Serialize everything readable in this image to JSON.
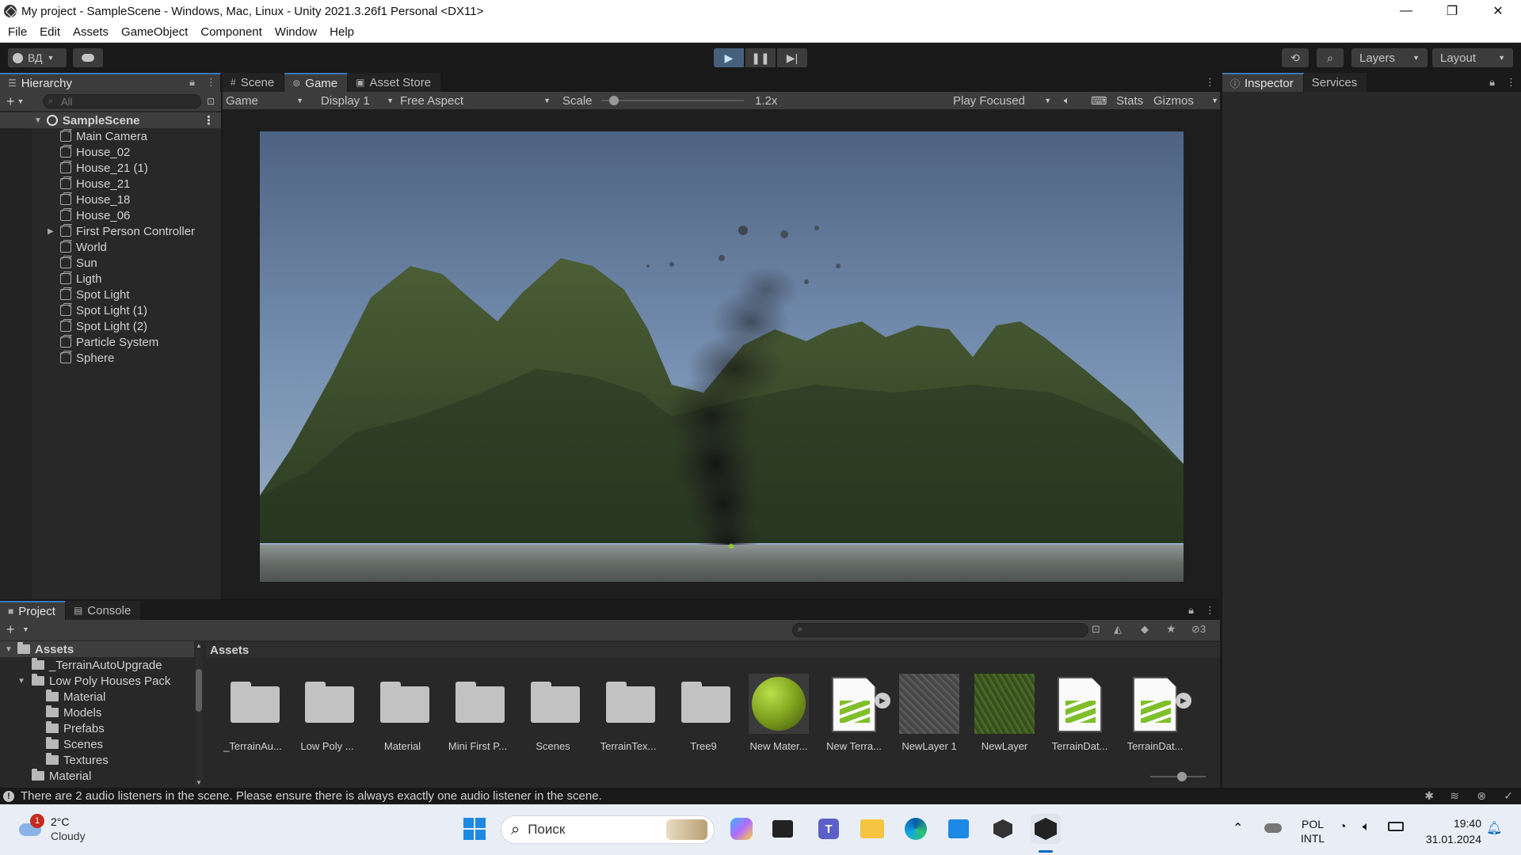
{
  "window": {
    "title": "My project - SampleScene - Windows, Mac, Linux - Unity 2021.3.26f1 Personal <DX11>",
    "minimize": "—",
    "maximize": "❐",
    "close": "✕"
  },
  "menu": [
    "File",
    "Edit",
    "Assets",
    "GameObject",
    "Component",
    "Window",
    "Help"
  ],
  "toolbar": {
    "account": "ВД",
    "layers": "Layers",
    "layout": "Layout"
  },
  "hierarchy": {
    "tab": "Hierarchy",
    "search_placeholder": "All",
    "scene": "SampleScene",
    "items": [
      {
        "label": "Main Camera"
      },
      {
        "label": "House_02"
      },
      {
        "label": "House_21 (1)"
      },
      {
        "label": "House_21"
      },
      {
        "label": "House_18"
      },
      {
        "label": "House_06"
      },
      {
        "label": "First Person Controller"
      },
      {
        "label": "World"
      },
      {
        "label": "Sun"
      },
      {
        "label": "Ligth"
      },
      {
        "label": "Spot Light"
      },
      {
        "label": "Spot Light (1)"
      },
      {
        "label": "Spot Light (2)"
      },
      {
        "label": "Particle System"
      },
      {
        "label": "Sphere"
      }
    ]
  },
  "center_tabs": [
    "Scene",
    "Game",
    "Asset Store"
  ],
  "game_options": {
    "view": "Game",
    "display": "Display 1",
    "aspect": "Free Aspect",
    "scale_label": "Scale",
    "scale_value": "1.2x",
    "play_mode": "Play Focused",
    "stats": "Stats",
    "gizmos": "Gizmos"
  },
  "inspector": {
    "tab": "Inspector",
    "services": "Services"
  },
  "project": {
    "tabs": [
      "Project",
      "Console"
    ],
    "hidden_count": "3",
    "breadcrumb": "Assets",
    "tree": [
      {
        "label": "Assets"
      },
      {
        "label": "_TerrainAutoUpgrade"
      },
      {
        "label": "Low Poly Houses Pack"
      },
      {
        "label": "Material"
      },
      {
        "label": "Models"
      },
      {
        "label": "Prefabs"
      },
      {
        "label": "Scenes"
      },
      {
        "label": "Textures"
      },
      {
        "label": "Material"
      }
    ],
    "assets": [
      {
        "label": "_TerrainAu...",
        "kind": "folder"
      },
      {
        "label": "Low Poly ...",
        "kind": "folder"
      },
      {
        "label": "Material",
        "kind": "folder"
      },
      {
        "label": "Mini First P...",
        "kind": "folder"
      },
      {
        "label": "Scenes",
        "kind": "folder"
      },
      {
        "label": "TerrainTex...",
        "kind": "folder"
      },
      {
        "label": "Tree9",
        "kind": "folder"
      },
      {
        "label": "New Mater...",
        "kind": "material"
      },
      {
        "label": "New Terra...",
        "kind": "terrain"
      },
      {
        "label": "NewLayer 1",
        "kind": "rock"
      },
      {
        "label": "NewLayer",
        "kind": "grass"
      },
      {
        "label": "TerrainDat...",
        "kind": "terrain"
      },
      {
        "label": "TerrainDat...",
        "kind": "terrain"
      }
    ]
  },
  "status": {
    "message": "There are 2 audio listeners in the scene. Please ensure there is always exactly one audio listener in the scene."
  },
  "taskbar": {
    "weather_temp": "2°C",
    "weather_desc": "Cloudy",
    "weather_badge": "1",
    "search_placeholder": "Поиск",
    "lang1": "POL",
    "lang2": "INTL",
    "time": "19:40",
    "date": "31.01.2024"
  },
  "colors": {
    "accent": "#3a79bb",
    "play_active": "#46607c",
    "panel": "#282828",
    "toolbar": "#191919",
    "grass": "#7fbf2a"
  }
}
